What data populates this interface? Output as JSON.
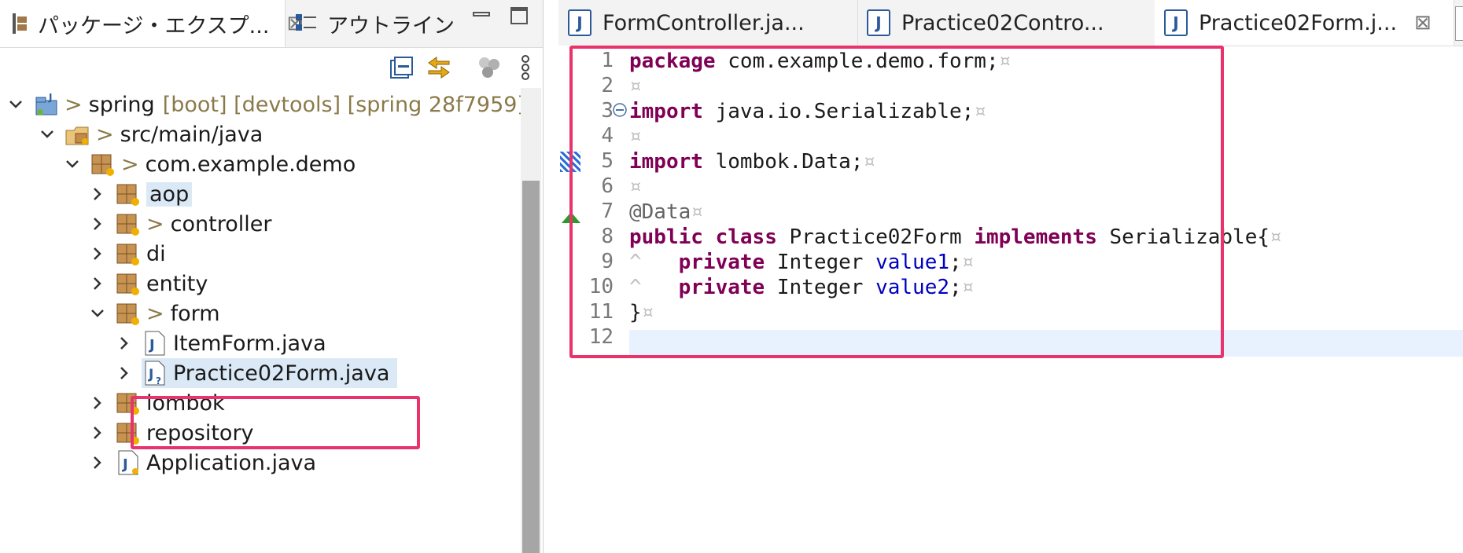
{
  "left_pane": {
    "tabs": [
      {
        "label": "パッケージ・エクスプ...",
        "active": true,
        "close": "⊠"
      },
      {
        "label": "アウトライン",
        "active": false
      }
    ],
    "tree": {
      "project": {
        "name": "spring",
        "decorations": "[boot] [devtools] [spring 28f7959]"
      },
      "source_folder": "src/main/java",
      "root_package": "com.example.demo",
      "packages": [
        {
          "name": "aop"
        },
        {
          "name": "controller"
        },
        {
          "name": "di"
        },
        {
          "name": "entity"
        },
        {
          "name": "form"
        },
        {
          "name": "lombok"
        },
        {
          "name": "repository"
        }
      ],
      "form_files": [
        {
          "name": "ItemForm.java"
        },
        {
          "name": "Practice02Form.java"
        }
      ],
      "root_file": "Application.java"
    },
    "dirty_marker": ">"
  },
  "editor": {
    "tabs": [
      {
        "label": "FormController.ja..."
      },
      {
        "label": "Practice02Contro..."
      },
      {
        "label": "Practice02Form.j...",
        "active": true,
        "close": "⊠"
      }
    ],
    "line_numbers": [
      "1",
      "2",
      "3",
      "4",
      "5",
      "6",
      "7",
      "8",
      "9",
      "10",
      "11",
      "12"
    ],
    "code": {
      "l1_kw": "package",
      "l1_rest": " com.example.demo.form;",
      "l3_kw": "import",
      "l3_rest": " java.io.Serializable;",
      "l5_kw": "import",
      "l5_rest": " lombok.Data;",
      "l7_ann": "@Data",
      "l8_kw1": "public",
      "l8_kw2": "class",
      "l8_name": " Practice02Form ",
      "l8_kw3": "implements",
      "l8_rest": " Serializable{",
      "l9_kw": "private",
      "l9_type": " Integer ",
      "l9_field": "value1",
      "l10_kw": "private",
      "l10_type": " Integer ",
      "l10_field": "value2",
      "semicolon": ";",
      "l11_brace": "}"
    },
    "whitespace_glyph": "¤",
    "tab_glyph": "^"
  },
  "colors": {
    "highlight_box": "#e8336d",
    "keyword": "#7f0055",
    "annotation": "#646464",
    "field": "#0000c0"
  }
}
